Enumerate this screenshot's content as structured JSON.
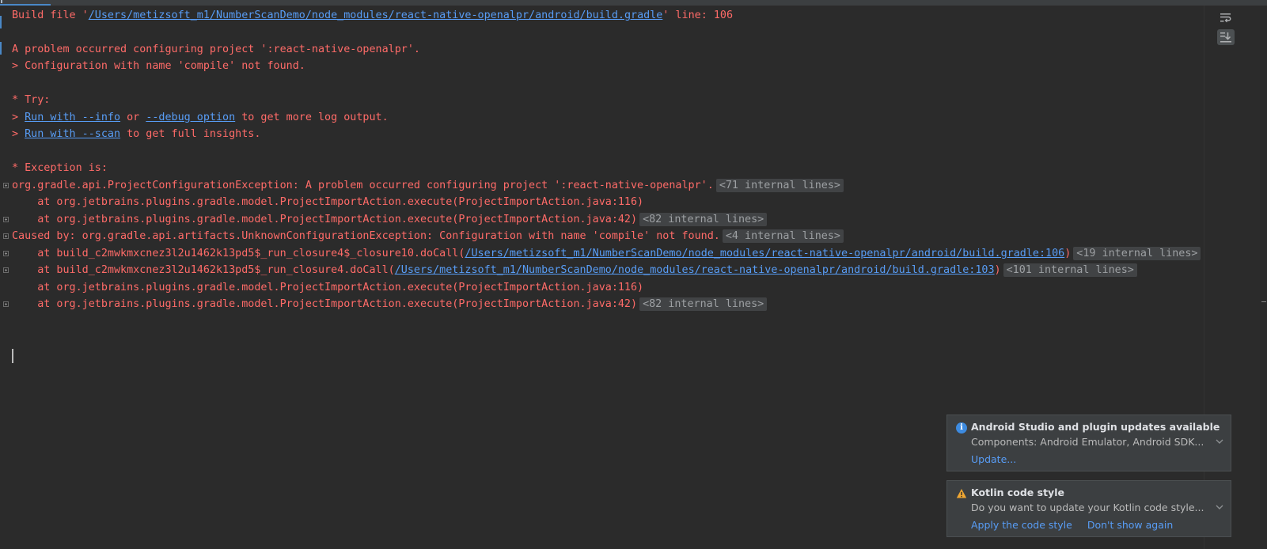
{
  "console": {
    "build_file_prefix": "Build file '",
    "build_file_path": "/Users/metizsoft_m1/NumberScanDemo/node_modules/react-native-openalpr/android/build.gradle",
    "build_file_suffix": "' line: 106",
    "problem_line": "A problem occurred configuring project ':react-native-openalpr'.",
    "config_line": "> Configuration with name 'compile' not found.",
    "try_header": "* Try:",
    "try1_prefix": "> ",
    "try1_link1": "Run with --info",
    "try1_mid": " or ",
    "try1_link2": "--debug option",
    "try1_suffix": " to get more log output.",
    "try2_prefix": "> ",
    "try2_link": "Run with --scan",
    "try2_suffix": " to get full insights.",
    "exception_header": "* Exception is:",
    "trace": [
      {
        "text": "org.gradle.api.ProjectConfigurationException: A problem occurred configuring project ':react-native-openalpr'.",
        "internal": "<71 internal lines>"
      },
      {
        "text": "    at org.jetbrains.plugins.gradle.model.ProjectImportAction.execute(ProjectImportAction.java:116)",
        "internal": ""
      },
      {
        "text": "    at org.jetbrains.plugins.gradle.model.ProjectImportAction.execute(ProjectImportAction.java:42)",
        "internal": "<82 internal lines>"
      },
      {
        "text": "Caused by: org.gradle.api.artifacts.UnknownConfigurationException: Configuration with name 'compile' not found.",
        "internal": "<4 internal lines>"
      },
      {
        "prefix": "    at build_c2mwkmxcnez3l2u1462k13pd5$_run_closure4$_closure10.doCall(",
        "link": "/Users/metizsoft_m1/NumberScanDemo/node_modules/react-native-openalpr/android/build.gradle:106",
        "suffix": ")",
        "internal": "<19 internal lines>"
      },
      {
        "prefix": "    at build_c2mwkmxcnez3l2u1462k13pd5$_run_closure4.doCall(",
        "link": "/Users/metizsoft_m1/NumberScanDemo/node_modules/react-native-openalpr/android/build.gradle:103",
        "suffix": ")",
        "internal": "<101 internal lines>"
      },
      {
        "text": "    at org.jetbrains.plugins.gradle.model.ProjectImportAction.execute(ProjectImportAction.java:116)",
        "internal": ""
      },
      {
        "text": "    at org.jetbrains.plugins.gradle.model.ProjectImportAction.execute(ProjectImportAction.java:42)",
        "internal": "<82 internal lines>"
      }
    ]
  },
  "notifications": [
    {
      "icon": "info-icon",
      "title": "Android Studio and plugin updates available",
      "body": "Components: Android Emulator, Android SDK...",
      "actions": [
        "Update..."
      ]
    },
    {
      "icon": "warning-icon",
      "title": "Kotlin code style",
      "body": "Do you want to update your Kotlin code style...",
      "actions": [
        "Apply the code style",
        "Don't show again"
      ]
    }
  ],
  "toolbar": {
    "soft_wrap_icon": "soft-wrap-icon",
    "scroll_to_end_icon": "scroll-to-end-icon"
  },
  "colors": {
    "background": "#2b2b2b",
    "error_text": "#ff6b68",
    "link": "#589df6",
    "internal_badge_bg": "#414345",
    "notification_bg": "#3c3f41"
  }
}
